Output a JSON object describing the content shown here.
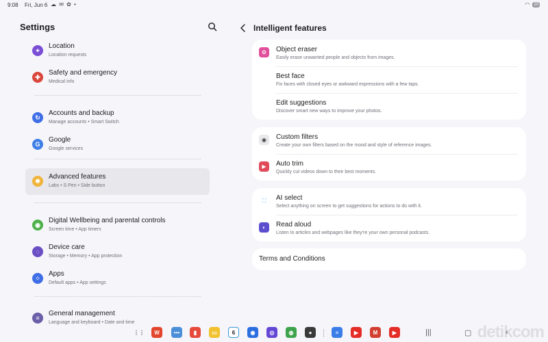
{
  "status_bar": {
    "time": "9:08",
    "date": "Fri, Jun 6",
    "notification_icons": "☁ ✉ ✿ •",
    "battery": "20"
  },
  "left_pane": {
    "title": "Settings",
    "items": [
      {
        "title": "Location",
        "subtitle": "Location requests",
        "icon": "location-icon",
        "color": "#7a4fd6"
      },
      {
        "title": "Safety and emergency",
        "subtitle": "Medical info",
        "icon": "safety-icon",
        "color": "#d9463b"
      },
      {
        "title": "Accounts and backup",
        "subtitle": "Manage accounts  •  Smart Switch",
        "icon": "sync-icon",
        "color": "#3f6ee6"
      },
      {
        "title": "Google",
        "subtitle": "Google services",
        "icon": "google-icon",
        "color": "#3f7fe8"
      },
      {
        "title": "Advanced features",
        "subtitle": "Labs  •  S Pen  •  Side button",
        "icon": "star-gear-icon",
        "color": "#f0b43a"
      },
      {
        "title": "Digital Wellbeing and parental controls",
        "subtitle": "Screen time  •  App timers",
        "icon": "wellbeing-icon",
        "color": "#4db14a"
      },
      {
        "title": "Device care",
        "subtitle": "Storage  •  Memory  •  App protection",
        "icon": "device-care-icon",
        "color": "#6a4fc4"
      },
      {
        "title": "Apps",
        "subtitle": "Default apps  •  App settings",
        "icon": "apps-icon",
        "color": "#3f6ee6"
      },
      {
        "title": "General management",
        "subtitle": "Language and keyboard  •  Date and time",
        "icon": "sliders-icon",
        "color": "#6a5fa8"
      }
    ]
  },
  "right_pane": {
    "title": "Intelligent features",
    "groups": [
      [
        {
          "title": "Object eraser",
          "desc": "Easily erase unwanted people and objects from images.",
          "icon": "object-eraser-icon",
          "color": "#e0509c"
        },
        {
          "title": "Best face",
          "desc": "Fix faces with closed eyes or awkward expressions with a few taps.",
          "icon": "",
          "color": ""
        },
        {
          "title": "Edit suggestions",
          "desc": "Discover smart new ways to improve your photos.",
          "icon": "",
          "color": ""
        }
      ],
      [
        {
          "title": "Custom filters",
          "desc": "Create your own filters based on the mood and style of reference images.",
          "icon": "camera-filter-icon",
          "color": "#3a3a3a"
        },
        {
          "title": "Auto trim",
          "desc": "Quickly cut videos down to their best moments.",
          "icon": "video-trim-icon",
          "color": "#e04a5a"
        }
      ],
      [
        {
          "title": "AI select",
          "desc": "Select anything on screen to get suggestions for actions to do with it.",
          "icon": "ai-select-icon",
          "color": "#4aa3d8"
        },
        {
          "title": "Read aloud",
          "desc": "Listen to articles and webpages like they're your own personal podcasts.",
          "icon": "read-aloud-icon",
          "color": "#5b4fd0"
        }
      ]
    ],
    "terms": "Terms and Conditions"
  },
  "dock": {
    "calendar_day": "6",
    "apps": [
      {
        "name": "apps-grid-icon",
        "color": "#555555",
        "label": "⋮⋮"
      },
      {
        "name": "wps-office-icon",
        "color": "#e2452b",
        "label": "W"
      },
      {
        "name": "more-apps-icon",
        "color": "#4a8fd8",
        "label": "•••"
      },
      {
        "name": "notes-red-icon",
        "color": "#e54a3a",
        "label": "▮"
      },
      {
        "name": "notes-yellow-icon",
        "color": "#f2c12e",
        "label": "▭"
      },
      {
        "name": "calendar-icon",
        "color": "#3a9ad8",
        "label": "6"
      },
      {
        "name": "messages-icon",
        "color": "#2d6fe0",
        "label": "◉"
      },
      {
        "name": "internet-icon",
        "color": "#6547d6",
        "label": "◎"
      },
      {
        "name": "chrome-icon",
        "color": "#3ea34d",
        "label": "◍"
      },
      {
        "name": "camera-icon",
        "color": "#3a3a3a",
        "label": "●"
      },
      {
        "name": "docs-icon",
        "color": "#3b7ee8",
        "label": "≡"
      },
      {
        "name": "youtube-icon",
        "color": "#e52d27",
        "label": "▶"
      },
      {
        "name": "gmail-icon",
        "color": "#d23f31",
        "label": "M"
      },
      {
        "name": "youtube-music-icon",
        "color": "#e52d27",
        "label": "▶"
      }
    ]
  }
}
